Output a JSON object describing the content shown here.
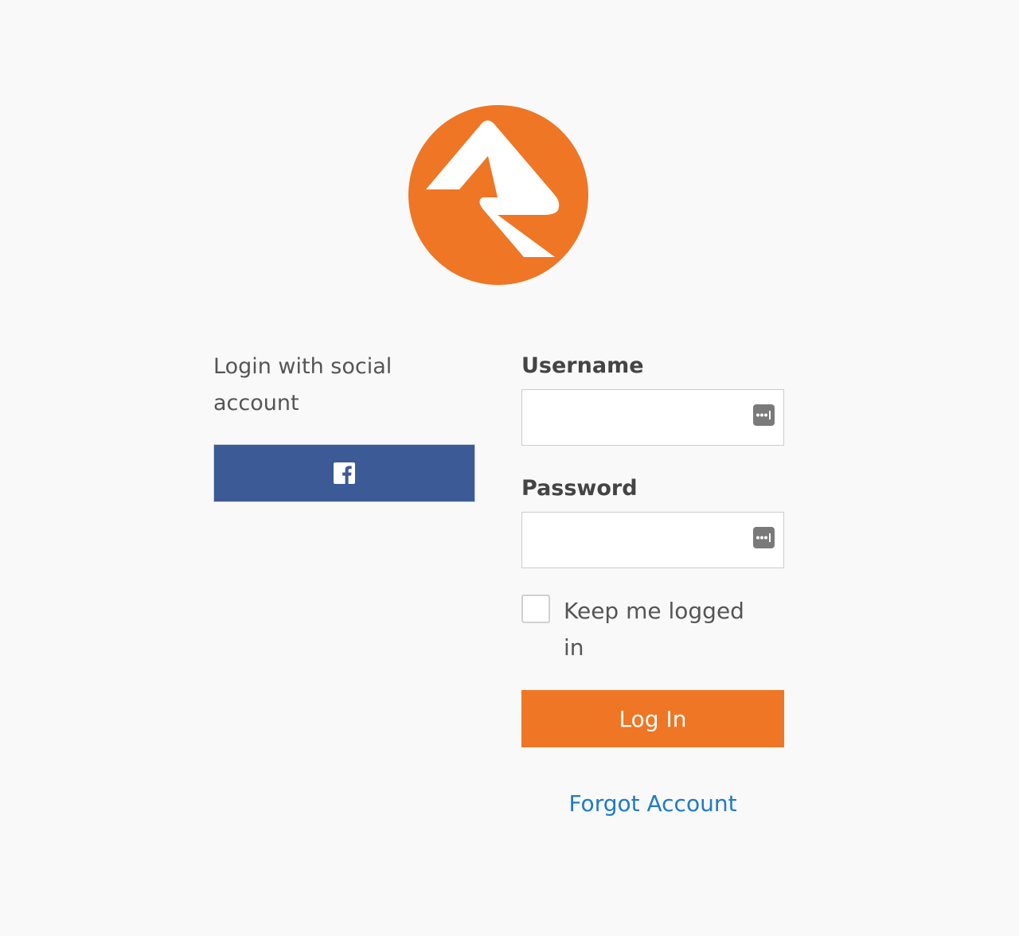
{
  "colors": {
    "background": "#f9f9f9",
    "brand_orange": "#ee7625",
    "facebook_blue": "#3c5a96",
    "link_blue": "#1f7ac9"
  },
  "logo": {
    "icon": "rock-logo-icon"
  },
  "social": {
    "heading": "Login with social account",
    "facebook_button": {
      "icon": "facebook-icon"
    }
  },
  "form": {
    "username": {
      "label": "Username",
      "value": "",
      "placeholder": "",
      "icon": "password-manager-icon"
    },
    "password": {
      "label": "Password",
      "value": "",
      "placeholder": "",
      "icon": "password-manager-icon"
    },
    "keep_logged_in": {
      "label": "Keep me logged in",
      "checked": false
    },
    "login_button_label": "Log In",
    "forgot_link_label": "Forgot Account"
  }
}
